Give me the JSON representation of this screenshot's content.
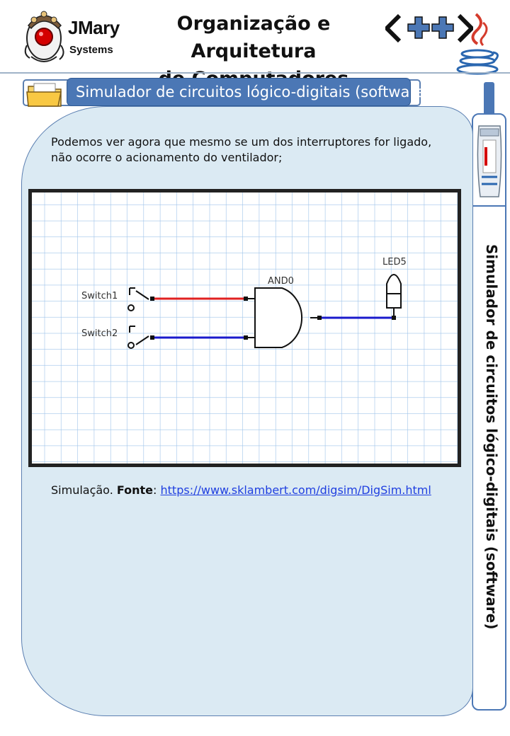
{
  "header": {
    "logo_line1": "JMary",
    "logo_line2": "Systems",
    "title_line1": "Organização e Arquitetura",
    "title_line2": "de Computadores"
  },
  "section": {
    "title": "Simulador de circuitos lógico-digitais (software)"
  },
  "side": {
    "label": "Simulador de circuitos lógico-digitais (software)"
  },
  "content": {
    "paragraph": "Podemos ver agora que mesmo se um dos interruptores for ligado, não ocorre o acionamento do ventilador;",
    "caption_prefix": "Simulação. ",
    "caption_bold": "Fonte",
    "caption_sep": ": ",
    "caption_link": "https://www.sklambert.com/digsim/DigSim.html"
  },
  "circuit": {
    "switch1_label": "Switch1",
    "switch2_label": "Switch2",
    "gate_label": "AND0",
    "led_label": "LED5",
    "switch1_on": false,
    "switch2_on": true,
    "led_on": false
  },
  "colors": {
    "accent": "#4b77b5",
    "panel_bg": "#dbeaf3",
    "grid_line": "#9ec3ea",
    "wire_active": "#e02020",
    "wire_inactive": "#1a1acc",
    "link": "#1f3fe0"
  }
}
